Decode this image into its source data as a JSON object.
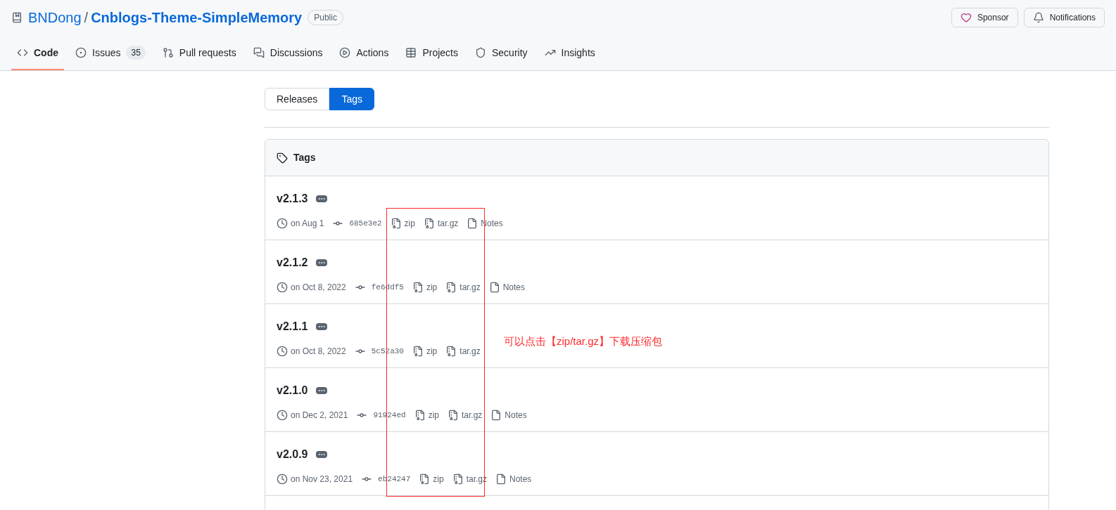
{
  "repo": {
    "owner": "BNDong",
    "separator": "/",
    "name": "Cnblogs-Theme-SimpleMemory",
    "visibility": "Public"
  },
  "header_buttons": [
    {
      "kind": "sponsor",
      "label": "Sponsor"
    },
    {
      "kind": "notifications",
      "label": "Notifications"
    }
  ],
  "tabs": [
    {
      "kind": "code",
      "label": "Code",
      "selected": true
    },
    {
      "kind": "issues",
      "label": "Issues",
      "count": "35",
      "selected": false
    },
    {
      "kind": "pulls",
      "label": "Pull requests",
      "selected": false
    },
    {
      "kind": "discussions",
      "label": "Discussions",
      "selected": false
    },
    {
      "kind": "actions",
      "label": "Actions",
      "selected": false
    },
    {
      "kind": "projects",
      "label": "Projects",
      "selected": false
    },
    {
      "kind": "security",
      "label": "Security",
      "selected": false
    },
    {
      "kind": "insights",
      "label": "Insights",
      "selected": false
    }
  ],
  "switcher": [
    {
      "label": "Releases",
      "selected": false
    },
    {
      "label": "Tags",
      "selected": true
    }
  ],
  "tags_panel": {
    "title": "Tags",
    "tags": [
      {
        "name": "v2.1.3",
        "date": "on Aug 1",
        "commit": "685e3e2",
        "zip": "zip",
        "targz": "tar.gz",
        "notes": "Notes"
      },
      {
        "name": "v2.1.2",
        "date": "on Oct 8, 2022",
        "commit": "fe6ddf5",
        "zip": "zip",
        "targz": "tar.gz",
        "notes": "Notes"
      },
      {
        "name": "v2.1.1",
        "date": "on Oct 8, 2022",
        "commit": "5c52a30",
        "zip": "zip",
        "targz": "tar.gz"
      },
      {
        "name": "v2.1.0",
        "date": "on Dec 2, 2021",
        "commit": "91924ed",
        "zip": "zip",
        "targz": "tar.gz",
        "notes": "Notes"
      },
      {
        "name": "v2.0.9",
        "date": "on Nov 23, 2021",
        "commit": "eb24247",
        "zip": "zip",
        "targz": "tar.gz",
        "notes": "Notes"
      }
    ]
  },
  "annotation": {
    "text": "可以点击【zip/tar.gz】下载压缩包"
  }
}
